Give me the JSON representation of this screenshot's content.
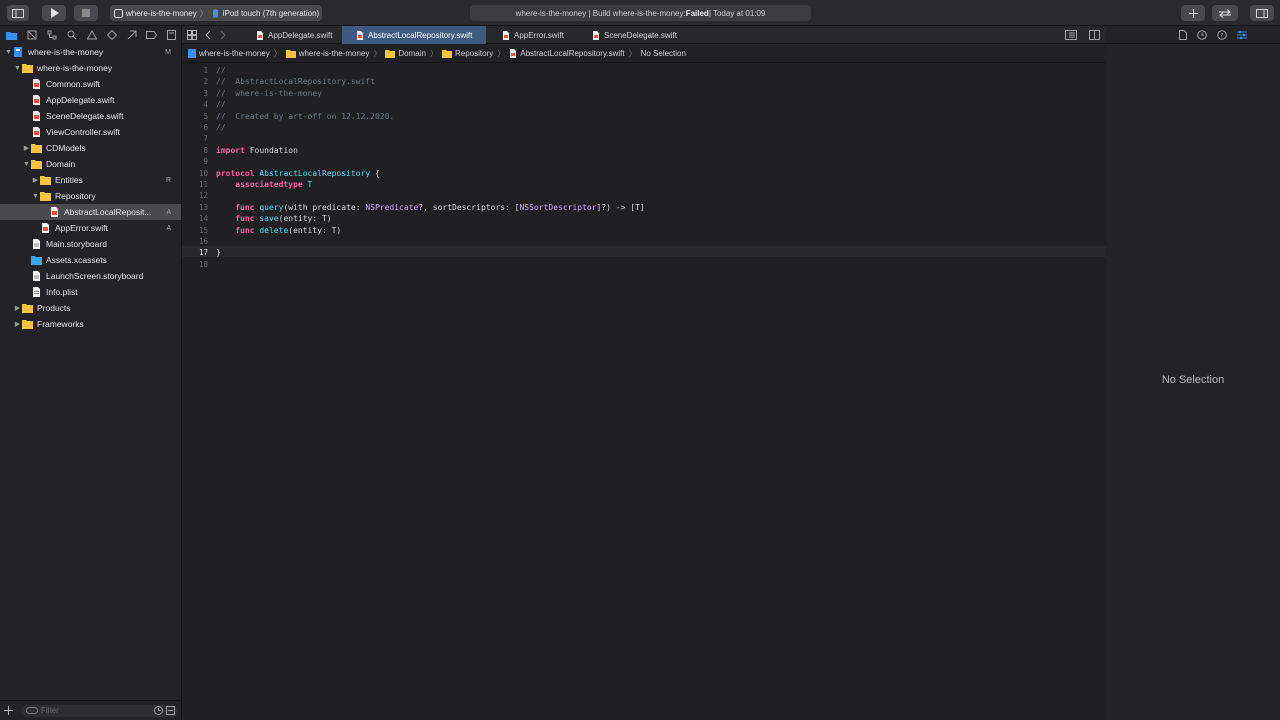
{
  "toolbar": {
    "scheme_project": "where-is-the-money",
    "scheme_device": "iPod touch (7th generation)",
    "status_prefix": "where-is-the-money | Build where-is-the-money: ",
    "status_result": "Failed",
    "status_suffix": " | Today at 01:09"
  },
  "navigator": {
    "filter_placeholder": "Filter",
    "items": [
      {
        "label": "where-is-the-money",
        "badge": "M"
      },
      {
        "label": "where-is-the-money",
        "badge": ""
      },
      {
        "label": "Common.swift",
        "badge": ""
      },
      {
        "label": "AppDelegate.swift",
        "badge": ""
      },
      {
        "label": "SceneDelegate.swift",
        "badge": ""
      },
      {
        "label": "ViewController.swift",
        "badge": ""
      },
      {
        "label": "CDModels",
        "badge": ""
      },
      {
        "label": "Domain",
        "badge": ""
      },
      {
        "label": "Entities",
        "badge": "R"
      },
      {
        "label": "Repository",
        "badge": ""
      },
      {
        "label": "AbstractLocalReposit...",
        "badge": "A"
      },
      {
        "label": "AppError.swift",
        "badge": "A"
      },
      {
        "label": "Main.storyboard",
        "badge": ""
      },
      {
        "label": "Assets.xcassets",
        "badge": ""
      },
      {
        "label": "LaunchScreen.storyboard",
        "badge": ""
      },
      {
        "label": "Info.plist",
        "badge": ""
      },
      {
        "label": "Products",
        "badge": ""
      },
      {
        "label": "Frameworks",
        "badge": ""
      }
    ]
  },
  "tabs": [
    {
      "label": "AppDelegate.swift"
    },
    {
      "label": "AbstractLocalRepository.swift"
    },
    {
      "label": "AppError.swift"
    },
    {
      "label": "SceneDelegate.swift"
    }
  ],
  "jumpbar": [
    "where-is-the-money",
    "where-is-the-money",
    "Domain",
    "Repository",
    "AbstractLocalRepository.swift",
    "No Selection"
  ],
  "editor": {
    "line_numbers": [
      "1",
      "2",
      "3",
      "4",
      "5",
      "6",
      "7",
      "8",
      "9",
      "10",
      "11",
      "12",
      "13",
      "14",
      "15",
      "16",
      "17",
      "18"
    ],
    "current_line": "17",
    "code": {
      "l1": "//",
      "l2": "//  AbstractLocalRepository.swift",
      "l3": "//  where-is-the-money",
      "l4": "//",
      "l5": "//  Created by art-off on 12.12.2020.",
      "l6": "//",
      "l8_kw": "import",
      "l8_rest": " Foundation",
      "l10_kw": "protocol",
      "l10_name": "AbstractLocalRepository",
      "l10_rest": " {",
      "l11_kw": "associatedtype",
      "l11_name": "T",
      "l13_kw": "func",
      "l13_fn": "query",
      "l13_a": "(with predicate: ",
      "l13_t1": "NSPredicate",
      "l13_b": "?, sortDescriptors: [",
      "l13_t2": "NSSortDescriptor",
      "l13_c": "]?) -> [T]",
      "l14_kw": "func",
      "l14_fn": "save",
      "l14_rest": "(entity: T)",
      "l15_kw": "func",
      "l15_fn": "delete",
      "l15_rest": "(entity: T)",
      "l17": "}"
    }
  },
  "inspector": {
    "empty_message": "No Selection"
  },
  "colors": {
    "keyword": "#fc5fa3",
    "comment": "#6c7986",
    "type": "#5dd8ff",
    "accent": "#3f5a80",
    "folder": "#f6c343"
  }
}
